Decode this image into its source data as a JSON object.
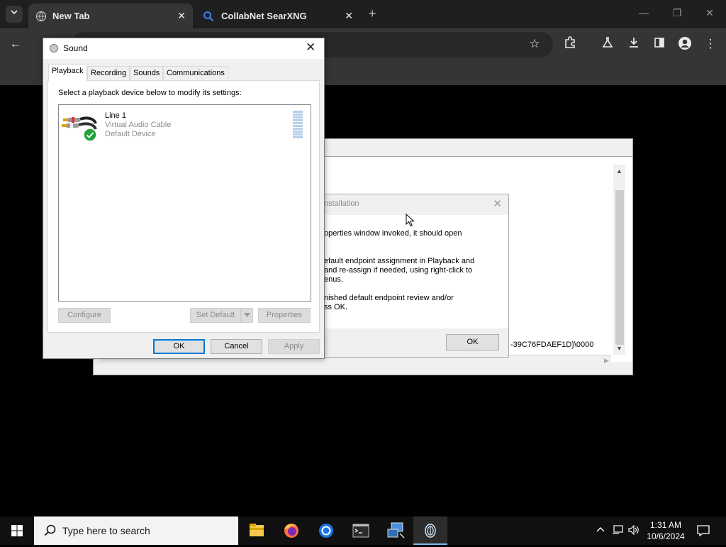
{
  "browser": {
    "tabs": [
      {
        "label": "New Tab",
        "active": true
      },
      {
        "label": "CollabNet SearXNG",
        "active": false
      }
    ],
    "new_tab_glyph": "+",
    "window_controls": [
      "minimize-icon",
      "restore-icon",
      "close-icon"
    ],
    "toolbar_icons": [
      "back-icon",
      "bookmark-star-icon",
      "extensions-icon",
      "labs-icon",
      "download-icon",
      "side-panel-icon",
      "profile-icon",
      "menu-icon"
    ]
  },
  "background_window": {
    "guid_text": "-39C76FDAEF1D}\\0000"
  },
  "install_dialog": {
    "title": "nstallation",
    "lines": [
      "operties window invoked, it should open",
      "efault endpoint assignment in Playback and",
      "and re-assign if needed, using right-click to",
      "enus.",
      "nished default endpoint review and/or",
      "ss OK."
    ],
    "ok_label": "OK"
  },
  "sound_dialog": {
    "title": "Sound",
    "tabs": [
      "Playback",
      "Recording",
      "Sounds",
      "Communications"
    ],
    "active_tab": "Playback",
    "instruction": "Select a playback device below to modify its settings:",
    "devices": [
      {
        "name": "Line 1",
        "description": "Virtual Audio Cable",
        "status": "Default Device",
        "is_default": true
      }
    ],
    "buttons": {
      "configure": "Configure",
      "set_default": "Set Default",
      "properties": "Properties",
      "ok": "OK",
      "cancel": "Cancel",
      "apply": "Apply"
    }
  },
  "taskbar": {
    "search_placeholder": "Type here to search",
    "apps": [
      "file-explorer-icon",
      "firefox-icon",
      "chrome-icon",
      "terminal-icon",
      "network-app-icon",
      "fingerprint-app-icon"
    ],
    "clock": {
      "time": "1:31 AM",
      "date": "10/6/2024"
    }
  },
  "colors": {
    "accent": "#0078d7",
    "chrome_dark": "#353535",
    "default_check": "#21a336"
  }
}
